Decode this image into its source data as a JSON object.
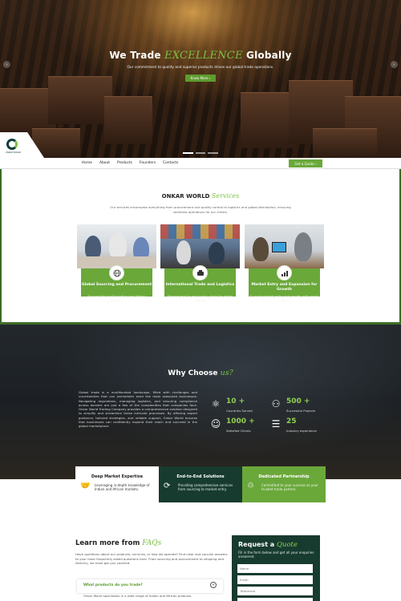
{
  "hero": {
    "title_pre": "We Trade",
    "title_script": "EXCELLENCE",
    "title_post": "Globally",
    "subtitle": "Our commitment to quality and superior products drives our global trade operations.",
    "button": "Know More",
    "button_icon": "chevron-right-icon",
    "prev_icon": "chevron-left-icon",
    "next_icon": "chevron-right-icon"
  },
  "nav": {
    "items": [
      "Home",
      "About",
      "Products",
      "Founders",
      "Contacts"
    ],
    "quote_button": "Get a Quote",
    "logo_text": "ONKAR WORLD"
  },
  "services": {
    "title": "ONKAR WORLD",
    "title_script": "Services",
    "description": "Our services encompass everything from procurement and quality control to logistics and global distribution, ensuring seamless operations for our clients.",
    "cards": [
      {
        "title": "Global Sourcing and Procurement",
        "desc": "Source high-quality Indian and African produce",
        "icon": "globe-icon"
      },
      {
        "title": "International Trade and Logistics",
        "desc": "Manage end-to-end supply chain for global markets",
        "icon": "handshake-icon"
      },
      {
        "title": "Market Entry and Expansion for Growth",
        "desc": "Support market entry and growth with smart insights",
        "icon": "chart-icon"
      }
    ]
  },
  "why": {
    "title": "Why Choose",
    "title_script": "us?",
    "text": "Global trade is a multifaceted landscape, filled with challenges and uncertainties that can overwhelm even the most seasoned businesses. Navigating regulations, managing logistics, and ensuring compliance across borders are just a few of the complexities that companies face. Onkar World Trading Company provides a comprehensive solution designed to simplify and streamline these intricate processes. By offering expert guidance, tailored strategies, and reliable support, Onkar World ensures that businesses can confidently expand their reach and succeed in the global marketplace.",
    "stats": [
      {
        "number": "10 +",
        "label": "Countries Served",
        "icon": "network-icon"
      },
      {
        "number": "500 +",
        "label": "Successful Projects",
        "icon": "team-icon"
      },
      {
        "number": "1000 +",
        "label": "Satisfied Clients",
        "icon": "smile-icon"
      },
      {
        "number": "25",
        "label": "Industry experience",
        "icon": "document-icon"
      }
    ]
  },
  "features": [
    {
      "title": "Deep Market Expertise",
      "desc": "Leveraging in-depth knowledge of Indian and African markets.",
      "icon": "handshake-icon"
    },
    {
      "title": "End-to-End Solutions",
      "desc": "Providing comprehensive services from sourcing to market entry.",
      "icon": "cycle-icon"
    },
    {
      "title": "Dedicated Partnership",
      "desc": "Committed to your success as your trusted trade partner.",
      "icon": "partnership-icon"
    }
  ],
  "faq": {
    "title": "Learn more from",
    "title_script": "FAQs",
    "description": "Have questions about our products, services, or how we operate? Find clear and concise answers to your most frequently asked questions here. From sourcing and procurement to shipping and delivery, we have got you covered.",
    "question": "What products do you trade?",
    "toggle": "+",
    "answer": "Onkar World specializes in a wide range of Indian and African products."
  },
  "quote": {
    "title": "Request a",
    "title_script": "Quote",
    "subtitle": "Fill in the form below and get all your enquiries answered.",
    "fields": [
      "Name",
      "Email",
      "Telephone"
    ]
  },
  "colors": {
    "accent": "#6aa83a",
    "dark_green": "#173b2f",
    "bright_green": "#8fd14f"
  }
}
